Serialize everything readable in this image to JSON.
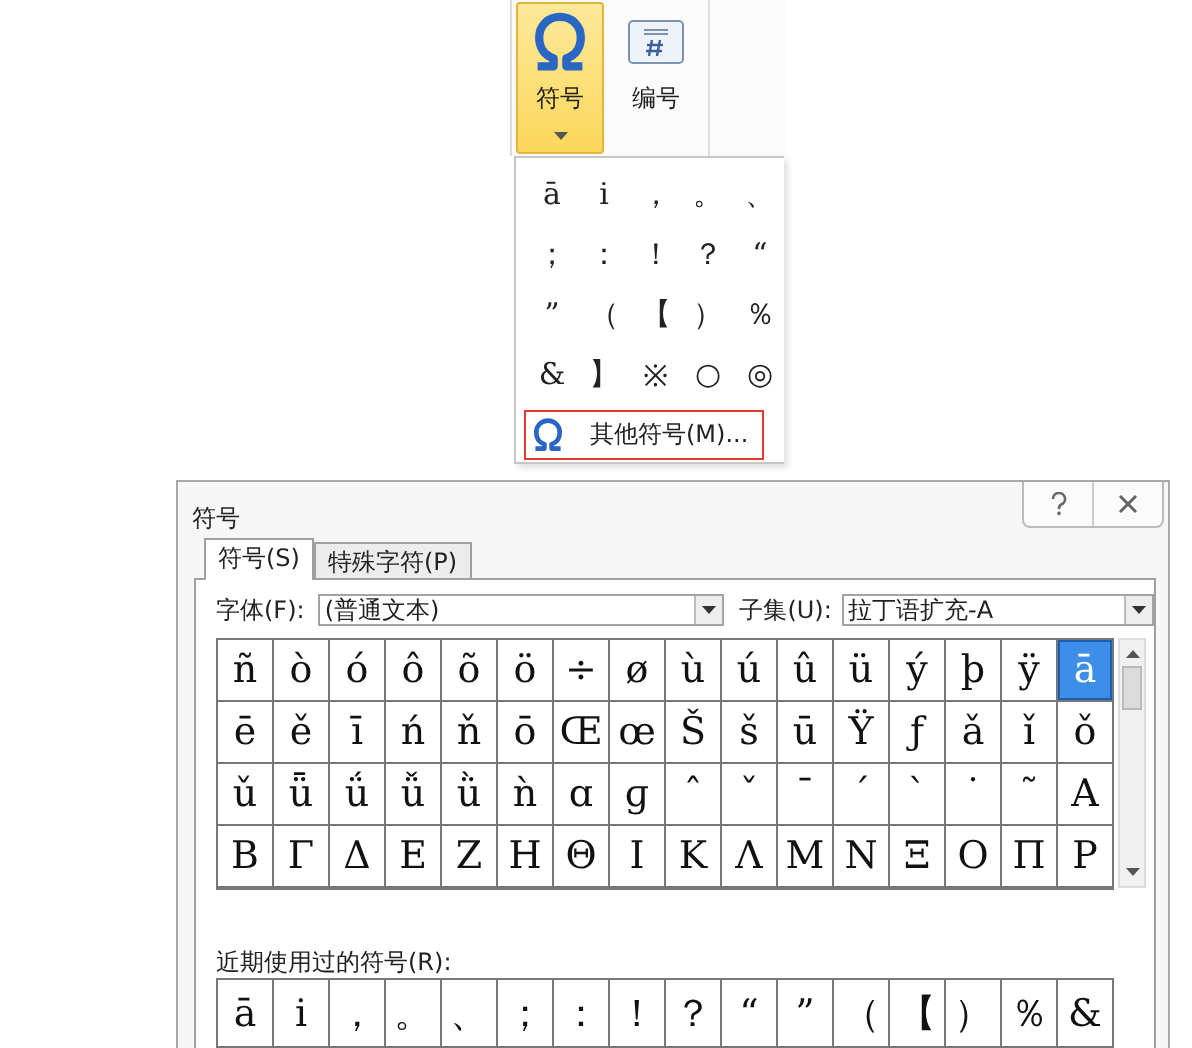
{
  "ribbon": {
    "buttons": [
      {
        "label": "符号",
        "kind": "omega",
        "selected": true
      },
      {
        "label": "编号",
        "kind": "number",
        "selected": false
      }
    ]
  },
  "menu": {
    "symbols": [
      "ā",
      "i",
      "，",
      "。",
      "、",
      "；",
      "：",
      "！",
      "？",
      "“",
      "”",
      "（",
      "【",
      "）",
      "％",
      "&",
      "】",
      "※",
      "○",
      "◎"
    ],
    "more": "其他符号(M)..."
  },
  "dialog": {
    "title": "符号",
    "tabs": [
      {
        "label": "符号(S)",
        "selected": true
      },
      {
        "label": "特殊字符(P)",
        "selected": false
      }
    ],
    "font": {
      "label": "字体(F):",
      "value": "(普通文本)"
    },
    "subset": {
      "label": "子集(U):",
      "value": "拉丁语扩充-A"
    },
    "symbols": [
      {
        "char": "ñ",
        "selected": false
      },
      {
        "char": "ò",
        "selected": false
      },
      {
        "char": "ó",
        "selected": false
      },
      {
        "char": "ô",
        "selected": false
      },
      {
        "char": "õ",
        "selected": false
      },
      {
        "char": "ö",
        "selected": false
      },
      {
        "char": "÷",
        "selected": false
      },
      {
        "char": "ø",
        "selected": false
      },
      {
        "char": "ù",
        "selected": false
      },
      {
        "char": "ú",
        "selected": false
      },
      {
        "char": "û",
        "selected": false
      },
      {
        "char": "ü",
        "selected": false
      },
      {
        "char": "ý",
        "selected": false
      },
      {
        "char": "þ",
        "selected": false
      },
      {
        "char": "ÿ",
        "selected": false
      },
      {
        "char": "ā",
        "selected": true
      },
      {
        "char": "ē",
        "selected": false
      },
      {
        "char": "ě",
        "selected": false
      },
      {
        "char": "ī",
        "selected": false
      },
      {
        "char": "ń",
        "selected": false
      },
      {
        "char": "ň",
        "selected": false
      },
      {
        "char": "ō",
        "selected": false
      },
      {
        "char": "Œ",
        "selected": false
      },
      {
        "char": "œ",
        "selected": false
      },
      {
        "char": "Š",
        "selected": false
      },
      {
        "char": "š",
        "selected": false
      },
      {
        "char": "ū",
        "selected": false
      },
      {
        "char": "Ÿ",
        "selected": false
      },
      {
        "char": "ƒ",
        "selected": false
      },
      {
        "char": "ǎ",
        "selected": false
      },
      {
        "char": "ǐ",
        "selected": false
      },
      {
        "char": "ǒ",
        "selected": false
      },
      {
        "char": "ǔ",
        "selected": false
      },
      {
        "char": "ǖ",
        "selected": false
      },
      {
        "char": "ǘ",
        "selected": false
      },
      {
        "char": "ǚ",
        "selected": false
      },
      {
        "char": "ǜ",
        "selected": false
      },
      {
        "char": "ǹ",
        "selected": false
      },
      {
        "char": "ɑ",
        "selected": false
      },
      {
        "char": "ɡ",
        "selected": false
      },
      {
        "char": "ˆ",
        "selected": false
      },
      {
        "char": "ˇ",
        "selected": false
      },
      {
        "char": "ˉ",
        "selected": false
      },
      {
        "char": "ˊ",
        "selected": false
      },
      {
        "char": "ˋ",
        "selected": false
      },
      {
        "char": "˙",
        "selected": false
      },
      {
        "char": "˜",
        "selected": false
      },
      {
        "char": "Α",
        "selected": false
      },
      {
        "char": "Β",
        "selected": false
      },
      {
        "char": "Γ",
        "selected": false
      },
      {
        "char": "Δ",
        "selected": false
      },
      {
        "char": "Ε",
        "selected": false
      },
      {
        "char": "Ζ",
        "selected": false
      },
      {
        "char": "Η",
        "selected": false
      },
      {
        "char": "Θ",
        "selected": false
      },
      {
        "char": "Ι",
        "selected": false
      },
      {
        "char": "Κ",
        "selected": false
      },
      {
        "char": "Λ",
        "selected": false
      },
      {
        "char": "Μ",
        "selected": false
      },
      {
        "char": "Ν",
        "selected": false
      },
      {
        "char": "Ξ",
        "selected": false
      },
      {
        "char": "Ο",
        "selected": false
      },
      {
        "char": "Π",
        "selected": false
      },
      {
        "char": "Ρ",
        "selected": false
      }
    ],
    "recent_label": "近期使用过的符号(R):",
    "recent": [
      "ā",
      "i",
      "，",
      "。",
      "、",
      "；",
      "：",
      "！",
      "？",
      "“",
      "”",
      "（",
      "【",
      "）",
      "％",
      "&"
    ]
  }
}
